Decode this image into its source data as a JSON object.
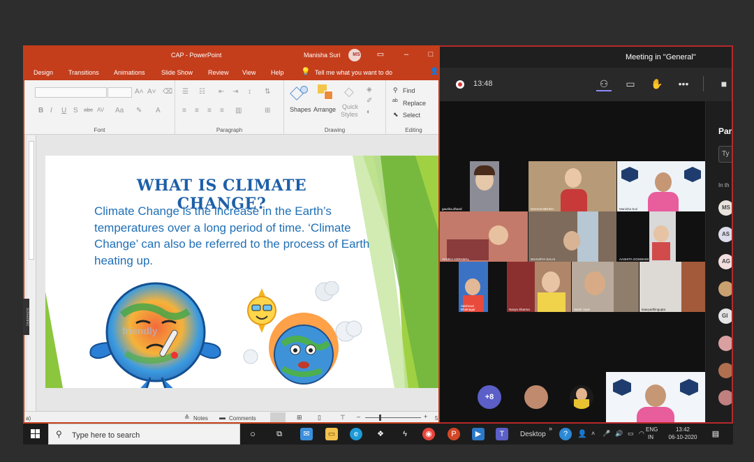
{
  "powerpoint": {
    "window_title": "CAP  -  PowerPoint",
    "user_name": "Manisha Suri",
    "user_initials": "MS",
    "menu": [
      "Design",
      "Transitions",
      "Animations",
      "Slide Show",
      "Review",
      "View",
      "Help"
    ],
    "tell_me": "Tell me what you want to do",
    "ribbon": {
      "font_group": "Font",
      "paragraph_group": "Paragraph",
      "drawing_group": "Drawing",
      "editing_group": "Editing",
      "shapes": "Shapes",
      "arrange": "Arrange",
      "quick": "Quick",
      "styles": "Styles",
      "find": "Find",
      "replace": "Replace",
      "select": "Select"
    },
    "slide": {
      "title": "WHAT IS CLIMATE CHANGE?",
      "body": "Climate Change is the increase in the Earth’s temperatures over a long period of time. ‘Climate Change’ can also be referred to the process of Earth heating up.",
      "watermark": "friendly"
    },
    "status": {
      "notes": "Notes",
      "comments": "Comments",
      "left_edge": "a)",
      "right_edge": "5"
    },
    "recorder_badge": "screenrec"
  },
  "teams": {
    "meeting_title": "Meeting in \"General\"",
    "timer": "13:48",
    "panel_title": "Par",
    "panel_search": "Ty",
    "panel_section": "In th",
    "overflow_count": "+8",
    "participants": [
      {
        "name": "gaurika.dhand"
      },
      {
        "name": "SOHAN  MEHRA"
      },
      {
        "name": "Manisha Suri"
      },
      {
        "name": "AVNIKA AGRAWAL"
      },
      {
        "name": "SHAURYA  SALAI"
      },
      {
        "name": "AASHITA GOSWAMI"
      },
      {
        "name": "Vaishnavi Bhatnagar"
      },
      {
        "name": "Navya Sharma"
      },
      {
        "name": "Samir  Vyas"
      },
      {
        "name": "kaavyadhingupta"
      }
    ],
    "side_avatars": [
      {
        "initials": "MS",
        "color": "#e8e4dc"
      },
      {
        "initials": "AS",
        "color": "#dcdcec"
      },
      {
        "initials": "AG",
        "color": "#f3dede"
      },
      {
        "initials": "",
        "color": "#c9a070"
      },
      {
        "initials": "GI",
        "color": "#e4e4e4"
      },
      {
        "initials": "",
        "color": "#d8a0a0"
      },
      {
        "initials": "",
        "color": "#b07050"
      },
      {
        "initials": "",
        "color": "#c08080"
      }
    ]
  },
  "taskbar": {
    "search_placeholder": "Type here to search",
    "desktop_label": "Desktop",
    "lang_top": "ENG",
    "lang_bottom": "IN",
    "time": "13:42",
    "date": "06-10-2020"
  }
}
